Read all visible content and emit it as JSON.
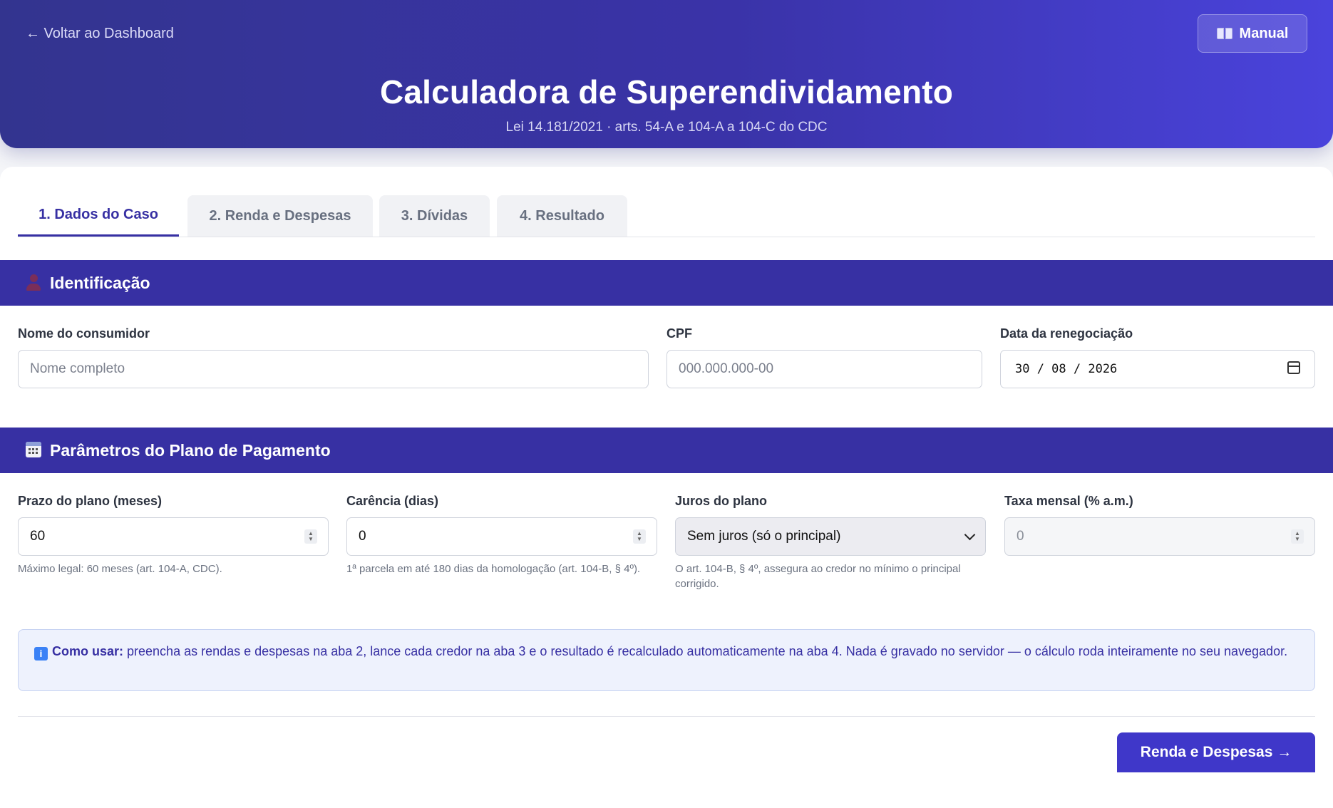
{
  "header": {
    "back_link": "← Voltar ao Dashboard",
    "manual_button": "Manual",
    "title": "Calculadora de Superendividamento",
    "subtitle": "Lei 14.181/2021 · arts. 54-A e 104-A a 104-C do CDC"
  },
  "tabs": [
    {
      "label": "1. Dados do Caso",
      "active": true
    },
    {
      "label": "2. Renda e Despesas",
      "active": false
    },
    {
      "label": "3. Dívidas",
      "active": false
    },
    {
      "label": "4. Resultado",
      "active": false
    }
  ],
  "identificacao": {
    "title": "Identificação",
    "icon": "user-icon",
    "nome_label": "Nome do consumidor",
    "nome_placeholder": "Nome completo",
    "cpf_label": "CPF",
    "cpf_placeholder": "000.000.000-00",
    "data_label": "Data da renegociação",
    "data_value": "30 / 08 / 2026"
  },
  "parametros": {
    "title": "Parâmetros do Plano de Pagamento",
    "icon": "calendar-icon",
    "prazo_label": "Prazo do plano (meses)",
    "prazo_value": "60",
    "prazo_help": "Máximo legal: 60 meses (art. 104-A, CDC).",
    "carencia_label": "Carência (dias)",
    "carencia_value": "0",
    "carencia_help": "1ª parcela em até 180 dias da homologação (art. 104-B, § 4º).",
    "juros_label": "Juros do plano",
    "juros_value": "Sem juros (só o principal)",
    "juros_help": "O art. 104-B, § 4º, assegura ao credor no mínimo o principal corrigido.",
    "taxa_label": "Taxa mensal (% a.m.)",
    "taxa_value": "0"
  },
  "info": {
    "icon": "info-icon",
    "bold": "Como usar:",
    "text": " preencha as rendas e despesas na aba 2, lance cada credor na aba 3 e o resultado é recalculado automaticamente na aba 4. Nada é gravado no servidor — o cálculo roda inteiramente no seu navegador."
  },
  "next_button": "Renda e Despesas →",
  "colors": {
    "primary": "#3730a3",
    "header_start": "#33348f",
    "header_end": "#4a43dc",
    "info_bg": "#eef2fd"
  }
}
